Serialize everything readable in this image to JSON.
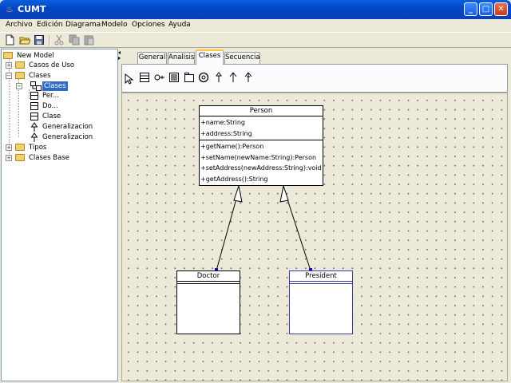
{
  "window": {
    "title": "CUMT"
  },
  "menu": [
    "Archivo",
    "Edición",
    "Diagrama",
    "Modelo",
    "Opciones",
    "Ayuda"
  ],
  "toolbar": [
    "new-file",
    "open-folder",
    "save",
    "cut",
    "copy",
    "paste"
  ],
  "tree": {
    "root": "New Model",
    "items": [
      {
        "label": "Casos de Uso"
      },
      {
        "label": "Clases"
      },
      {
        "label": "Clases"
      },
      {
        "label": "Per..."
      },
      {
        "label": "Do..."
      },
      {
        "label": "Clase"
      },
      {
        "label": "Generalizacion"
      },
      {
        "label": "Generalizacion"
      },
      {
        "label": "Tipos"
      },
      {
        "label": "Clases Base"
      }
    ]
  },
  "tabs": [
    {
      "label": "General"
    },
    {
      "label": "Analisis"
    },
    {
      "label": "Clases",
      "active": true
    },
    {
      "label": "Secuencia"
    }
  ],
  "palette": [
    "select-pointer",
    "class",
    "interface",
    "package",
    "note",
    "association",
    "dependency",
    "generalization",
    "realization"
  ],
  "diagram": {
    "classes": [
      {
        "name": "Person",
        "attributes": [
          "+name:String",
          "+address:String"
        ],
        "operations": [
          "+getName():Person",
          "+setName(newName:String):Person",
          "+setAddress(newAddress:String):void",
          "+getAddress():String"
        ]
      },
      {
        "name": "Doctor",
        "attributes": [],
        "operations": []
      },
      {
        "name": "President",
        "attributes": [],
        "operations": []
      }
    ],
    "relations": [
      {
        "type": "generalization",
        "from": "Doctor",
        "to": "Person"
      },
      {
        "type": "generalization",
        "from": "President",
        "to": "Person"
      }
    ]
  },
  "colors": {
    "titlebar": "#0348c8",
    "selection": "#316ac5",
    "canvas": "#ece9d8"
  }
}
